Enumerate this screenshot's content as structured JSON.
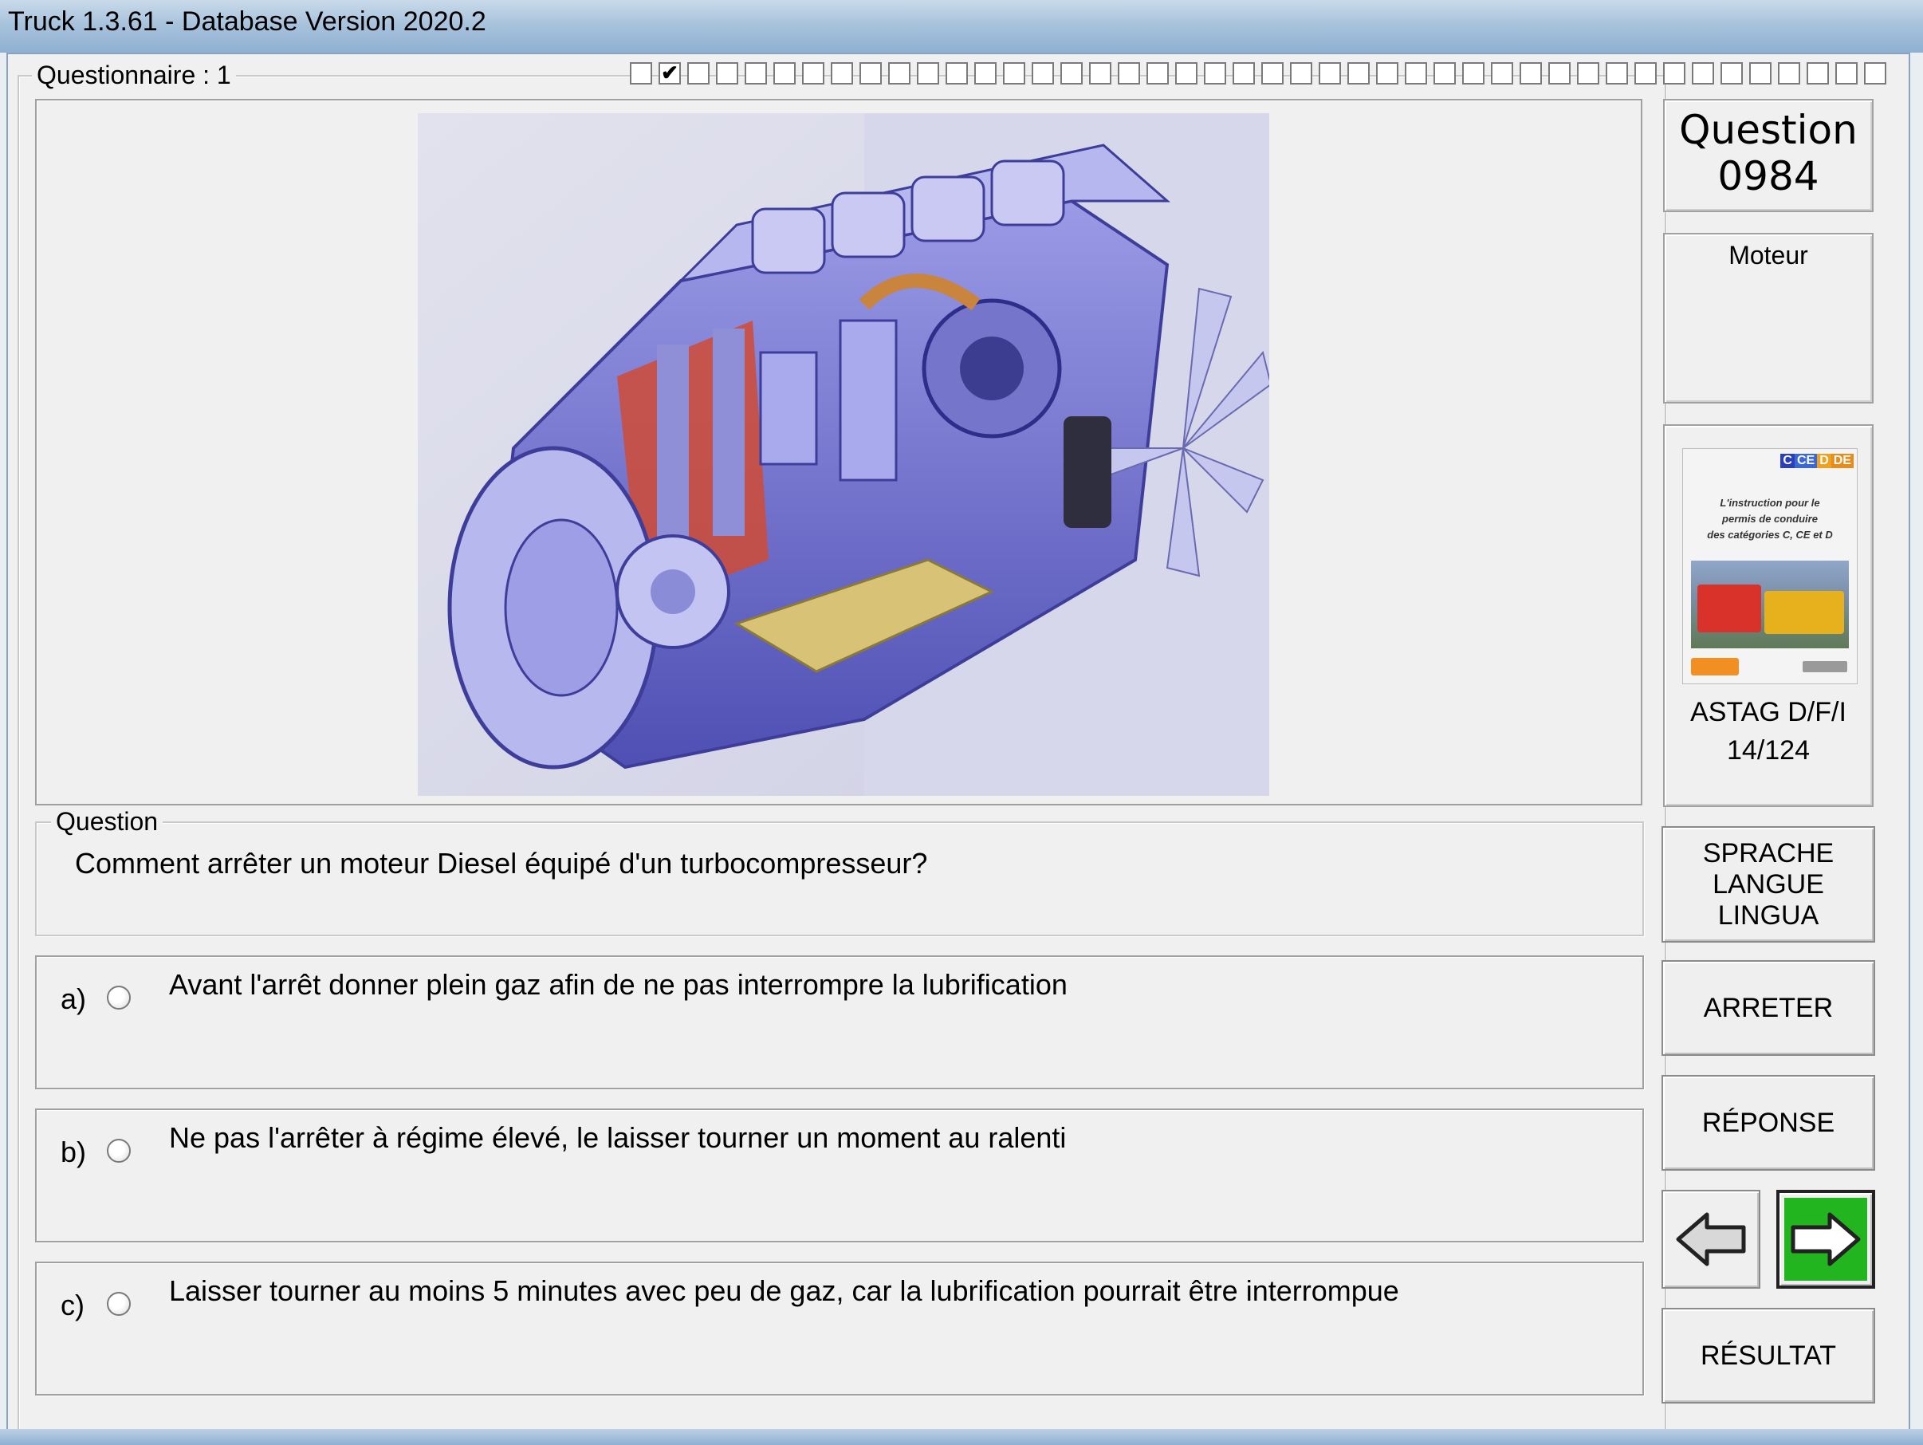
{
  "window": {
    "title": "Truck 1.3.61 - Database Version 2020.2"
  },
  "questionnaire": {
    "label": "Questionnaire : 1",
    "checkboxes": [
      {
        "checked": false
      },
      {
        "checked": true
      },
      {
        "checked": false
      },
      {
        "checked": false
      },
      {
        "checked": false
      },
      {
        "checked": false
      },
      {
        "checked": false
      },
      {
        "checked": false
      },
      {
        "checked": false
      },
      {
        "checked": false
      },
      {
        "checked": false
      },
      {
        "checked": false
      },
      {
        "checked": false
      },
      {
        "checked": false
      },
      {
        "checked": false
      },
      {
        "checked": false
      },
      {
        "checked": false
      },
      {
        "checked": false
      },
      {
        "checked": false
      },
      {
        "checked": false
      },
      {
        "checked": false
      },
      {
        "checked": false
      },
      {
        "checked": false
      },
      {
        "checked": false
      },
      {
        "checked": false
      },
      {
        "checked": false
      },
      {
        "checked": false
      },
      {
        "checked": false
      },
      {
        "checked": false
      },
      {
        "checked": false
      },
      {
        "checked": false
      },
      {
        "checked": false
      },
      {
        "checked": false
      },
      {
        "checked": false
      },
      {
        "checked": false
      },
      {
        "checked": false
      },
      {
        "checked": false
      },
      {
        "checked": false
      },
      {
        "checked": false
      },
      {
        "checked": false
      },
      {
        "checked": false
      },
      {
        "checked": false
      },
      {
        "checked": false
      },
      {
        "checked": false
      }
    ]
  },
  "question_header": {
    "label": "Question",
    "number": "0984"
  },
  "category": "Moteur",
  "book": {
    "badge_letters": [
      "C",
      "CE",
      "D",
      "DE"
    ],
    "cover_lines": [
      "L'instruction pour le",
      "permis de conduire",
      "des catégories C, CE et D"
    ],
    "source": "ASTAG D/F/I",
    "page": "14/124"
  },
  "question": {
    "group_label": "Question",
    "text": "Comment arrêter un moteur Diesel équipé d'un turbocompresseur?"
  },
  "answers": [
    {
      "letter": "a)",
      "text": "Avant l'arrêt donner plein gaz afin de ne pas interrompre la lubrification"
    },
    {
      "letter": "b)",
      "text": "Ne pas l'arrêter à régime élevé, le laisser tourner un moment au ralenti"
    },
    {
      "letter": "c)",
      "text": "Laisser tourner au moins 5 minutes avec peu de gaz, car la lubrification pourrait être interrompue"
    }
  ],
  "buttons": {
    "language": "SPRACHE\nLANGUE\nLINGUA",
    "stop": "ARRETER",
    "answer": "RÉPONSE",
    "result": "RÉSULTAT"
  },
  "colors": {
    "next_button_bg": "#22b51f",
    "engine_blue": "#6a6ad0",
    "engine_red": "#c8462f"
  },
  "icons": {
    "prev": "left-arrow-icon",
    "next": "right-arrow-icon"
  }
}
